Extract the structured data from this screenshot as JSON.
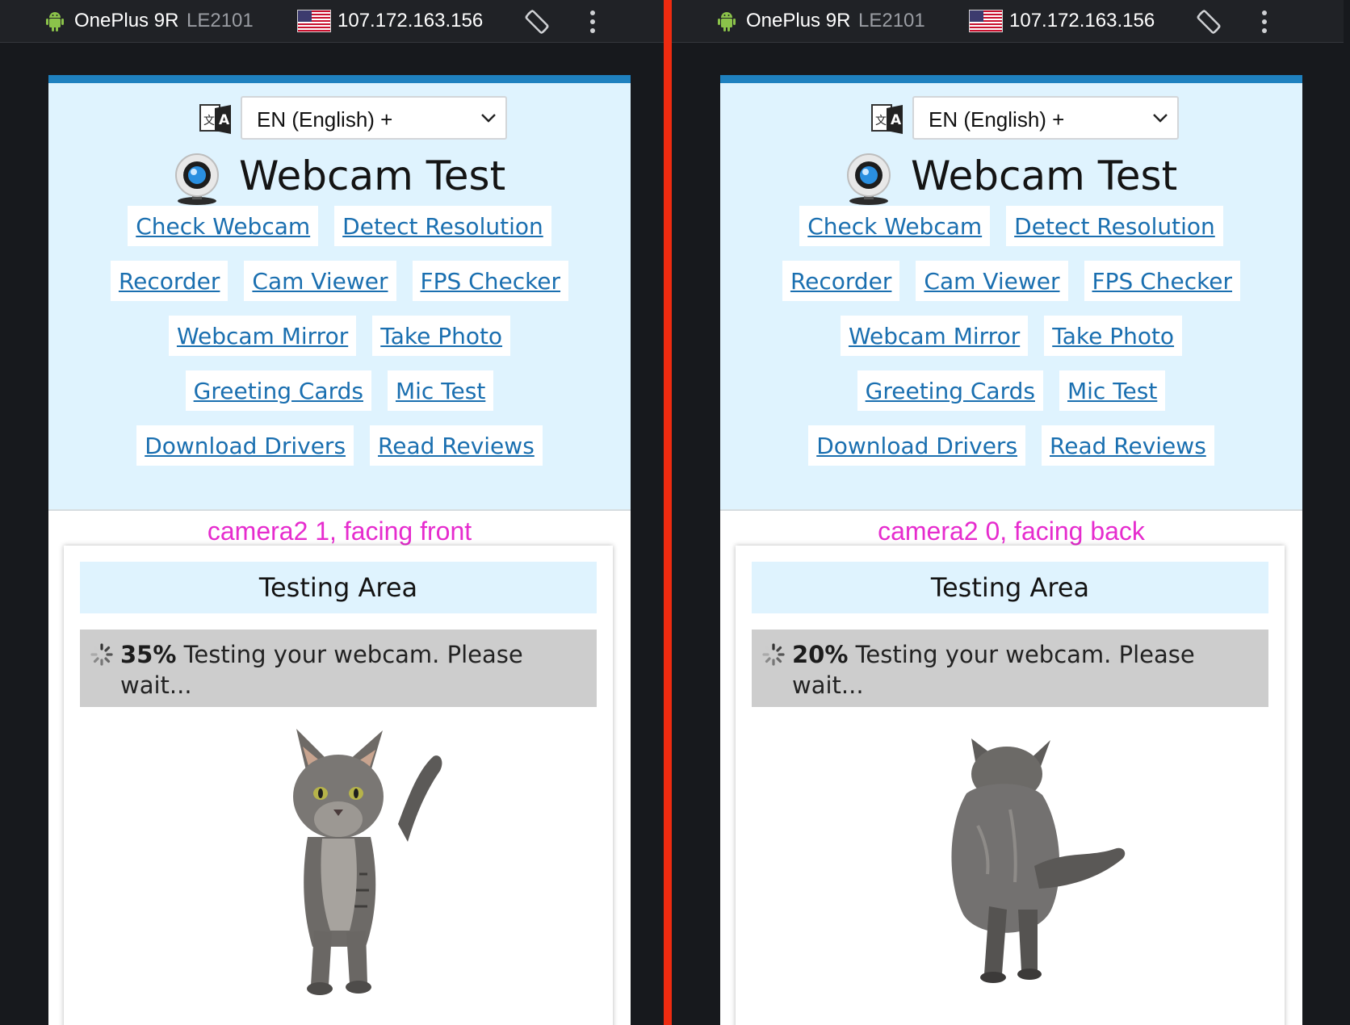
{
  "panels": [
    {
      "device": {
        "name": "OnePlus 9R",
        "model": "LE2101",
        "ip": "107.172.163.156"
      },
      "language": {
        "selected": "EN (English) +"
      },
      "title": "Webcam Test",
      "nav": [
        [
          "Check Webcam",
          "Detect Resolution"
        ],
        [
          "Recorder",
          "Cam Viewer",
          "FPS Checker"
        ],
        [
          "Webcam Mirror",
          "Take Photo"
        ],
        [
          "Greeting Cards",
          "Mic Test"
        ],
        [
          "Download Drivers",
          "Read Reviews"
        ]
      ],
      "camera_label": "camera2 1, facing front",
      "testing_title": "Testing Area",
      "progress": {
        "percent": "35%",
        "message": "Testing your webcam. Please wait..."
      },
      "cat_view": "front"
    },
    {
      "device": {
        "name": "OnePlus 9R",
        "model": "LE2101",
        "ip": "107.172.163.156"
      },
      "language": {
        "selected": "EN (English) +"
      },
      "title": "Webcam Test",
      "nav": [
        [
          "Check Webcam",
          "Detect Resolution"
        ],
        [
          "Recorder",
          "Cam Viewer",
          "FPS Checker"
        ],
        [
          "Webcam Mirror",
          "Take Photo"
        ],
        [
          "Greeting Cards",
          "Mic Test"
        ],
        [
          "Download Drivers",
          "Read Reviews"
        ]
      ],
      "camera_label": "camera2 0, facing back",
      "testing_title": "Testing Area",
      "progress": {
        "percent": "20%",
        "message": "Testing your webcam. Please wait..."
      },
      "cat_view": "back"
    }
  ],
  "colors": {
    "accent": "#1f81bf",
    "header_bg": "#dff3fe",
    "link": "#1a6fb0",
    "camera_label": "#e62cce",
    "divider": "#ee2b10"
  }
}
